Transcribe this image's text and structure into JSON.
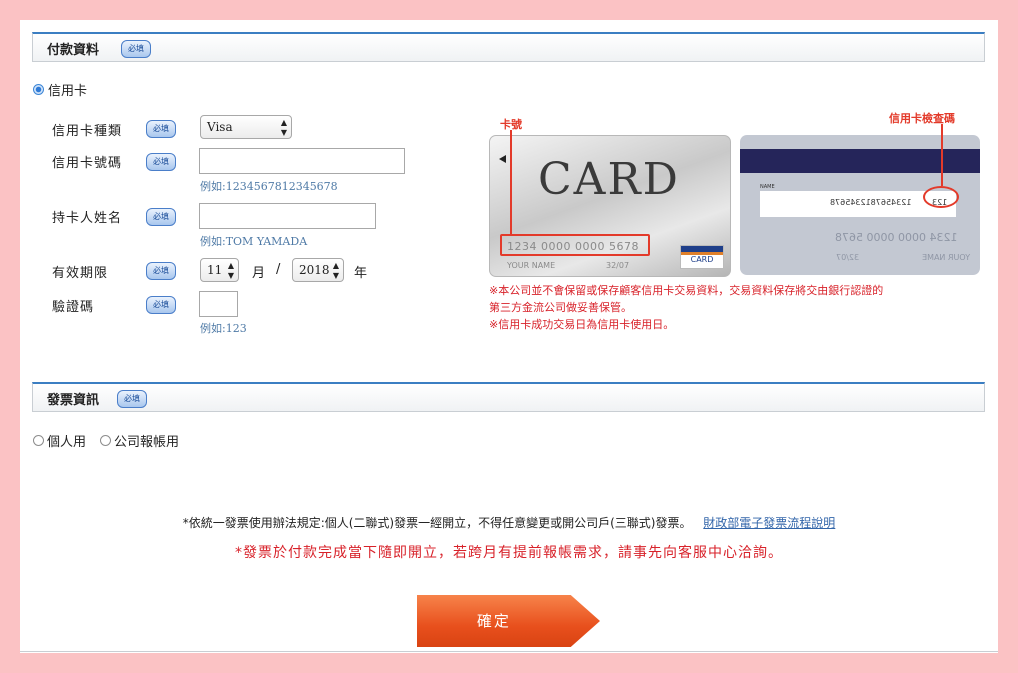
{
  "payment": {
    "title": "付款資料",
    "required_badge": "必填",
    "method_label": "信用卡",
    "card_type": {
      "label": "信用卡種類",
      "badge": "必填",
      "selected": "Visa"
    },
    "card_number": {
      "label": "信用卡號碼",
      "badge": "必填",
      "value": "",
      "example": "例如:1234567812345678"
    },
    "holder_name": {
      "label": "持卡人姓名",
      "badge": "必填",
      "value": "",
      "example": "例如:TOM YAMADA"
    },
    "expiry": {
      "label": "有效期限",
      "badge": "必填",
      "month": "11",
      "month_unit": "月",
      "separator": "/",
      "year": "2018",
      "year_unit": "年"
    },
    "cvv": {
      "label": "驗證碼",
      "badge": "必填",
      "value": "",
      "example": "例如:123"
    }
  },
  "card_illustration": {
    "number_annotation": "卡號",
    "cvv_annotation": "信用卡檢查碼",
    "front_title": "CARD",
    "front_number": "1234 0000 0000 5678",
    "front_name": "YOUR NAME",
    "front_date": "32/07",
    "front_logo": "CARD",
    "back_name_label": "NAME",
    "back_strip_digits": "1234567812345678",
    "back_cvv": "123",
    "back_number": "1234 0000 0000 5678",
    "back_name": "YOUR NAME",
    "back_date": "32/07"
  },
  "notes": {
    "line1": "※本公司並不會保留或保存顧客信用卡交易資料，交易資料保存將交由銀行認證的",
    "line2": "第三方金流公司做妥善保管。",
    "line3": "※信用卡成功交易日為信用卡使用日。"
  },
  "invoice": {
    "title": "發票資訊",
    "badge": "必填",
    "option_personal": "個人用",
    "option_company": "公司報帳用",
    "rule_text": "*依統一發票使用辦法規定:個人(二聯式)發票一經開立，不得任意變更或開公司戶(三聯式)發票。",
    "rule_link": "財政部電子發票流程說明",
    "warning": "*發票於付款完成當下隨即開立，若跨月有提前報帳需求，請事先向客服中心洽詢。"
  },
  "confirm_button": "確定",
  "colors": {
    "accent_blue": "#3b7ec2",
    "warning_red": "#d8222a",
    "button_orange": "#e8501d",
    "background_pink": "#fbc2c4"
  }
}
